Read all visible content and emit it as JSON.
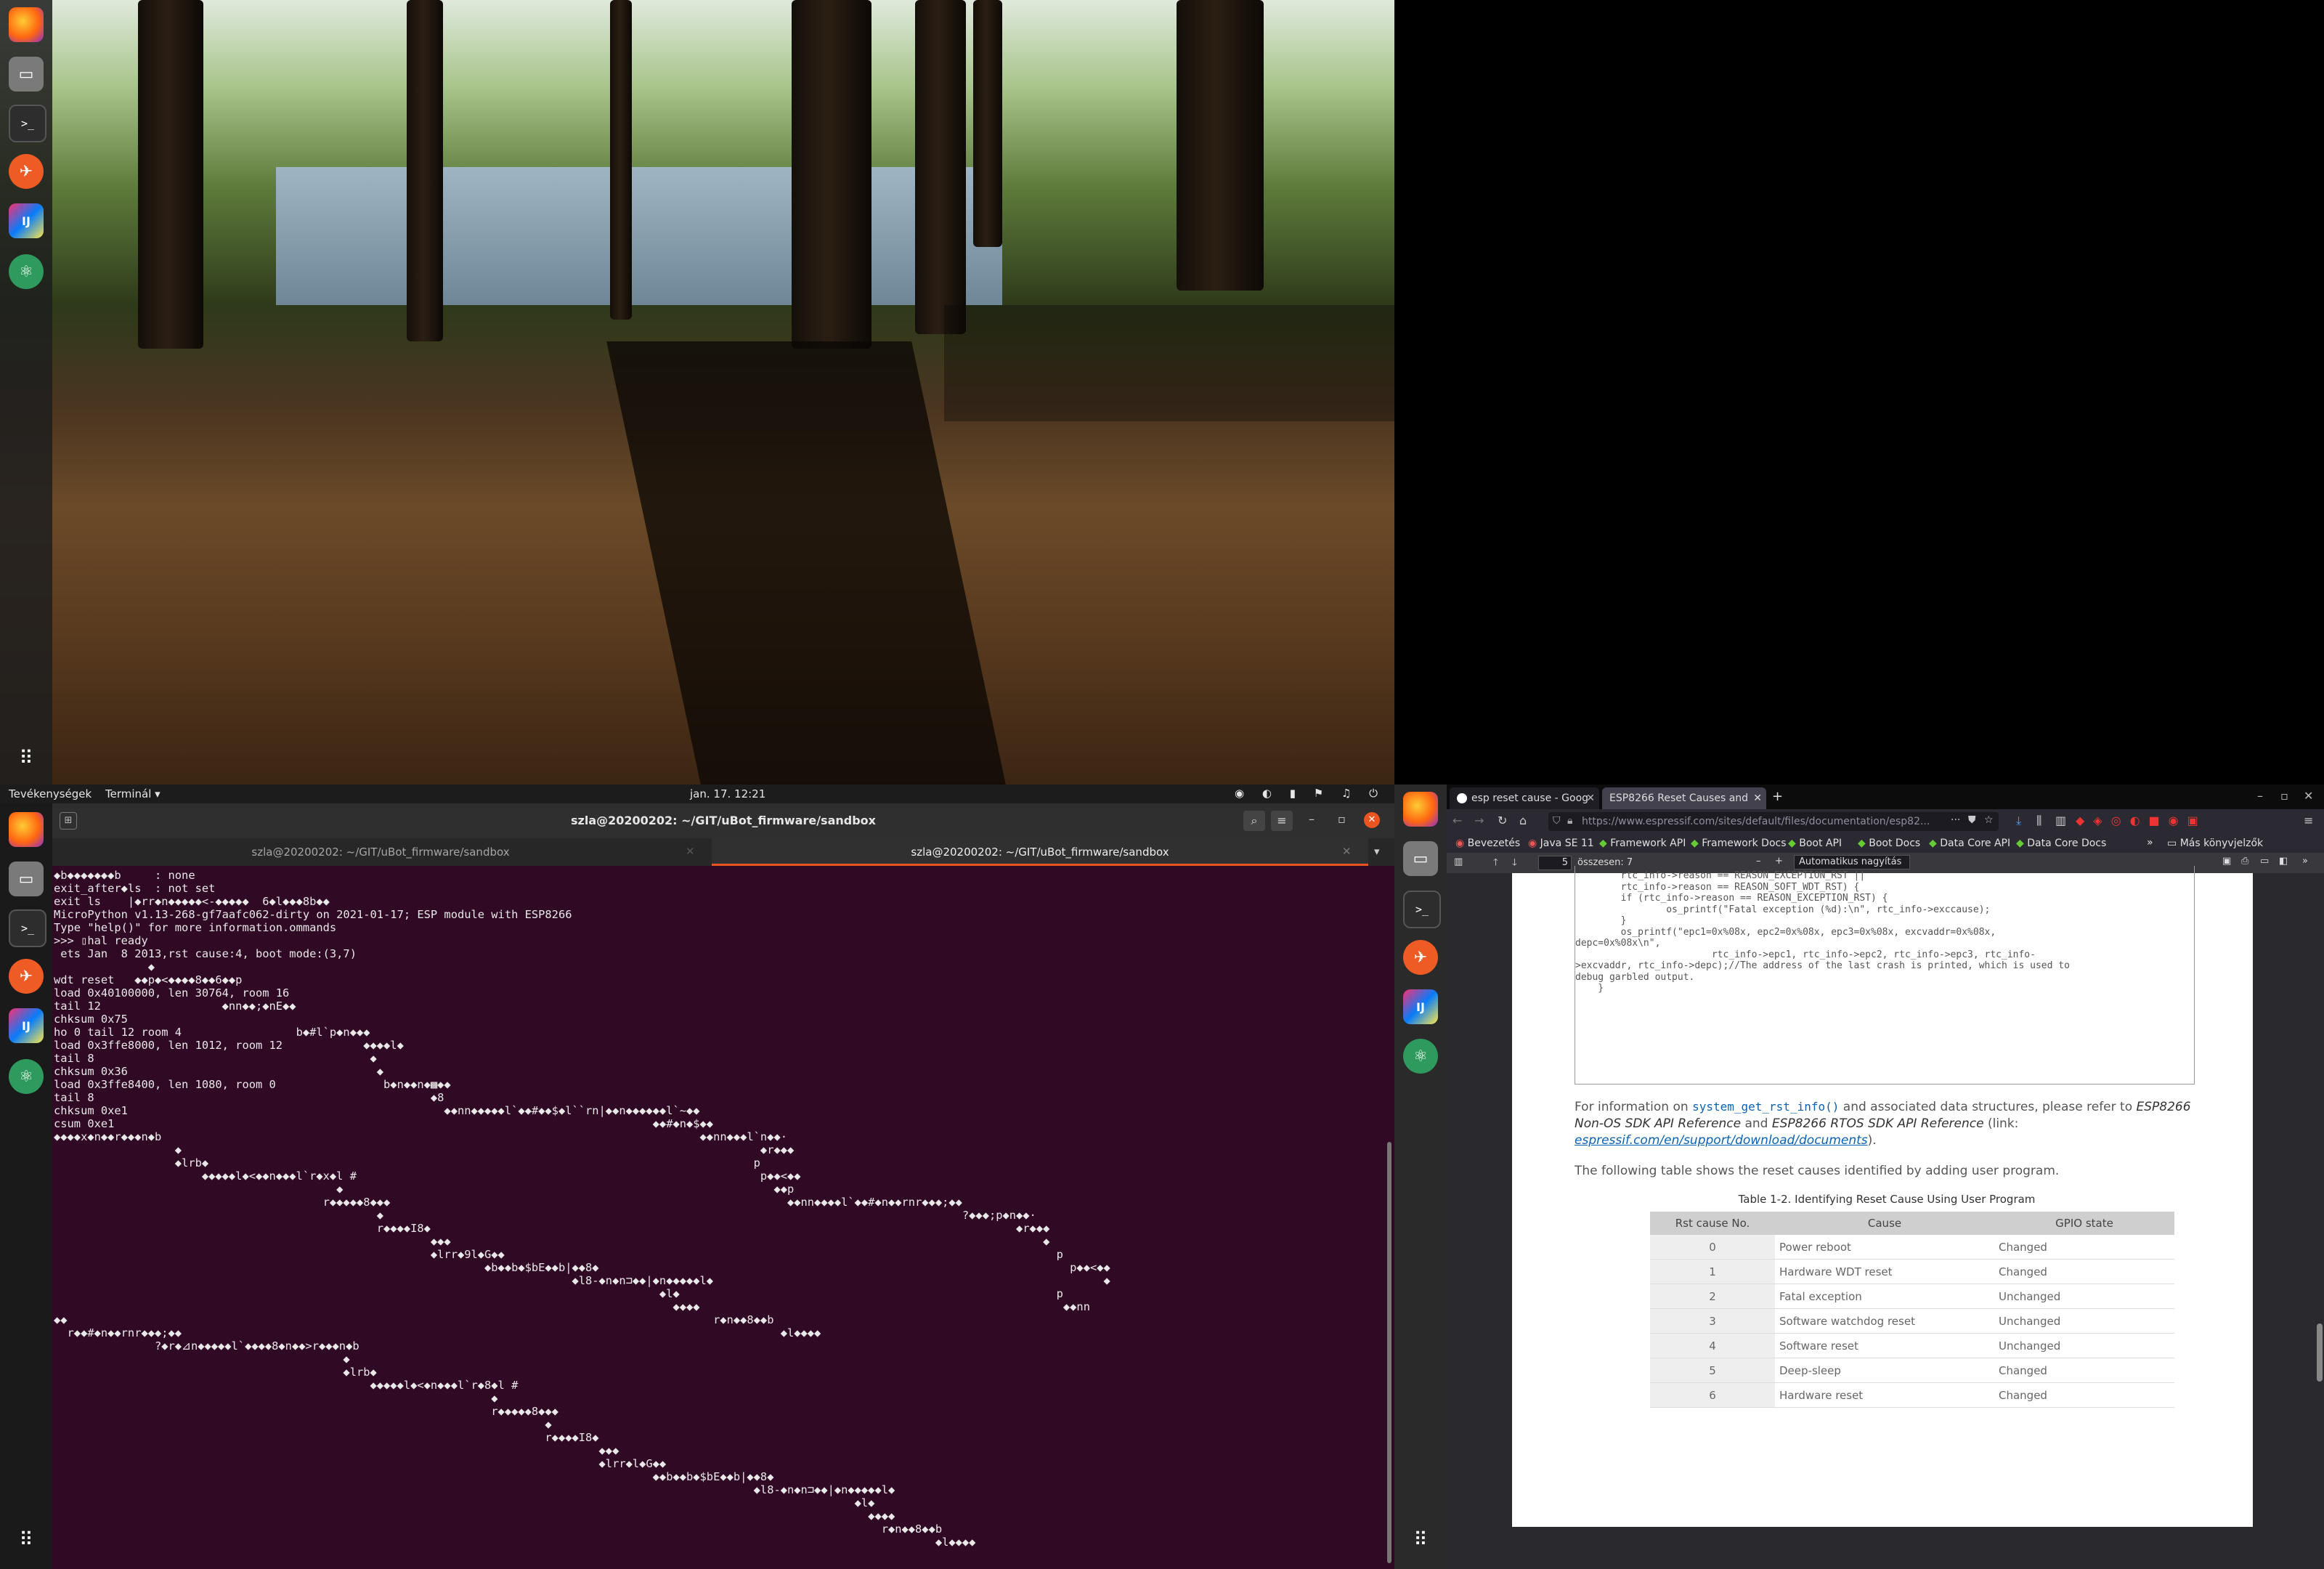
{
  "top_panel": {
    "activities": "Tevékenységek",
    "app_menu": "Terminál ▾",
    "clock": "jan. 17.  12:21"
  },
  "terminal": {
    "title": "szla@20200202: ~/GIT/uBot_firmware/sandbox",
    "tabs": [
      {
        "label": "szla@20200202: ~/GIT/uBot_firmware/sandbox"
      },
      {
        "label": "szla@20200202: ~/GIT/uBot_firmware/sandbox"
      }
    ],
    "output": "◆b◆◆◆◆◆◆◆b     : none\nexit_after◆ls  : not set\nexit ls    |◆rr◆n◆◆◆◆◆<-◆◆◆◆◆  6◆l◆◆◆8b◆◆\nMicroPython v1.13-268-gf7aafc062-dirty on 2021-01-17; ESP module with ESP8266\nType \"help()\" for more information.ommands\n>>> ▯hal ready\n ets Jan  8 2013,rst cause:4, boot mode:(3,7)\n              ◆\nwdt reset   ◆◆p◆<◆◆◆◆8◆◆6◆◆p\nload 0x40100000, len 30764, room 16\ntail 12                  ◆nn◆◆;◆nE◆◆\nchksum 0x75\nho 0 tail 12 room 4                 b◆#l`p◆n◆◆◆\nload 0x3ffe8000, len 1012, room 12            ◆◆◆◆l◆\ntail 8                                         ◆\nchksum 0x36                                     ◆\nload 0x3ffe8400, len 1080, room 0                b◆n◆◆n◆▩◆◆\ntail 8                                                  ◆8\nchksum 0xe1                                               ◆◆nn◆◆◆◆◆l`◆◆#◆◆$◆l``rn|◆◆n◆◆◆◆◆◆l`~◆◆\ncsum 0xe1                                                                                ◆◆#◆n◆$◆◆\n◆◆◆◆x◆n◆◆r◆◆◆n◆b                                                                                ◆◆nn◆◆◆l`n◆◆·\n                  ◆                                                                                      ◆r◆◆◆\n                  ◆lrb◆                                                                                 p\n                      ◆◆◆◆◆l◆<◆◆n◆◆◆l`r◆x◆l #                                                            p◆◆<◆◆\n                                          ◆                                                                ◆◆p\n                                        r◆◆◆◆◆8◆◆◆                                                           ◆◆nn◆◆◆◆l`◆◆#◆n◆◆rnr◆◆◆;◆◆\n                                                ◆                                                                                      ?◆◆◆;p◆n◆◆·\n                                                r◆◆◆◆I8◆                                                                                       ◆r◆◆◆\n                                                        ◆◆◆                                                                                        ◆\n                                                        ◆lrr◆9l◆G◆◆                                                                                  p\n                                                                ◆b◆◆b◆$bE◆◆b|◆◆8◆                                                                      p◆◆<◆◆\n                                                                             ◆l8-◆n◆n⊐◆◆|◆n◆◆◆◆◆l◆                                                          ◆\n                                                                                          ◆l◆                                                        p\n                                                                                            ◆◆◆◆                                                      ◆◆nn\n◆◆                                                                                                r◆n◆◆8◆◆b\n  r◆◆#◆n◆◆rnr◆◆◆;◆◆                                                                                         ◆l◆◆◆◆\n               ?◆r◆⊿n◆◆◆◆◆l`◆◆◆◆8◆n◆◆>r◆◆◆n◆b\n                                           ◆\n                                           ◆lrb◆\n                                               ◆◆◆◆◆l◆<◆n◆◆◆l`r◆8◆l #\n                                                                 ◆\n                                                                 r◆◆◆◆◆8◆◆◆\n                                                                         ◆\n                                                                         r◆◆◆◆I8◆\n                                                                                 ◆◆◆\n                                                                                 ◆lrr◆l◆G◆◆\n                                                                                         ◆◆b◆◆b◆$bE◆◆b|◆◆8◆\n                                                                                                        ◆l8-◆n◆n⊐◆◆|◆n◆◆◆◆◆l◆\n                                                                                                                       ◆l◆\n                                                                                                                         ◆◆◆◆\n                                                                                                                           r◆n◆◆8◆◆b\n                                                                                                                                   ◆l◆◆◆◆"
  },
  "firefox": {
    "tabs": [
      {
        "label": "esp reset cause - Google",
        "active": false
      },
      {
        "label": "ESP8266 Reset Causes and",
        "active": true
      }
    ],
    "new_tab": "+",
    "url": "https://www.espressif.com/sites/default/files/documentation/esp82...",
    "bookmarks": [
      "Bevezetés",
      "Java SE 11",
      "Framework API",
      "Framework Docs",
      "Boot API",
      "Boot Docs",
      "Data Core API",
      "Data Core Docs"
    ],
    "other_bookmarks": "Más könyvjelzők",
    "pdf_toolbar": {
      "page_number": "5",
      "page_total": "összesen: 7",
      "zoom": "Automatikus nagyítás"
    }
  },
  "pdf": {
    "code_lines": [
      "        rtc_info->reason == REASON_EXCEPTION_RST ||",
      "",
      "        rtc_info->reason == REASON_SOFT_WDT_RST) {",
      "",
      "        if (rtc_info->reason == REASON_EXCEPTION_RST) {",
      "",
      "                os_printf(\"Fatal exception (%d):\\n\", rtc_info->exccause);",
      "",
      "        }",
      "",
      "        os_printf(\"epc1=0x%08x, epc2=0x%08x, epc3=0x%08x, excvaddr=0x%08x,",
      "depc=0x%08x\\n\",",
      "",
      "                        rtc_info->epc1, rtc_info->epc2, rtc_info->epc3, rtc_info-",
      ">excvaddr, rtc_info->depc);//The address of the last crash is printed, which is used to",
      "debug garbled output.",
      "",
      "    }"
    ],
    "para1_prefix": "For information on ",
    "para1_code": "system_get_rst_info()",
    "para1_mid": " and associated data structures, please refer to ",
    "para1_ref1": "ESP8266 Non-OS SDK API Reference",
    "para1_and": " and ",
    "para1_ref2": "ESP8266 RTOS SDK API Reference",
    "para1_link_prefix": " (link: ",
    "para1_link": "espressif.com/en/support/download/documents",
    "para1_suffix": ").",
    "para2": "The following table shows the reset causes identified by adding user program.",
    "table_caption": "Table 1-2. Identifying Reset Cause Using User Program",
    "table_headers": [
      "Rst cause No.",
      "Cause",
      "GPIO state"
    ],
    "table_rows": [
      [
        "0",
        "Power reboot",
        "Changed"
      ],
      [
        "1",
        "Hardware WDT reset",
        "Changed"
      ],
      [
        "2",
        "Fatal exception",
        "Unchanged"
      ],
      [
        "3",
        "Software watchdog reset",
        "Unchanged"
      ],
      [
        "4",
        "Software reset",
        "Unchanged"
      ],
      [
        "5",
        "Deep-sleep",
        "Changed"
      ],
      [
        "6",
        "Hardware reset",
        "Changed"
      ]
    ]
  },
  "colors": {
    "terminal_bg": "#300a24",
    "terminal_accent": "#e95420",
    "link": "#0b62b3"
  },
  "dock_icons": [
    "firefox-icon",
    "files-icon",
    "terminal-icon",
    "postman-icon",
    "intellij-icon",
    "atom-icon",
    "show-apps-icon"
  ]
}
